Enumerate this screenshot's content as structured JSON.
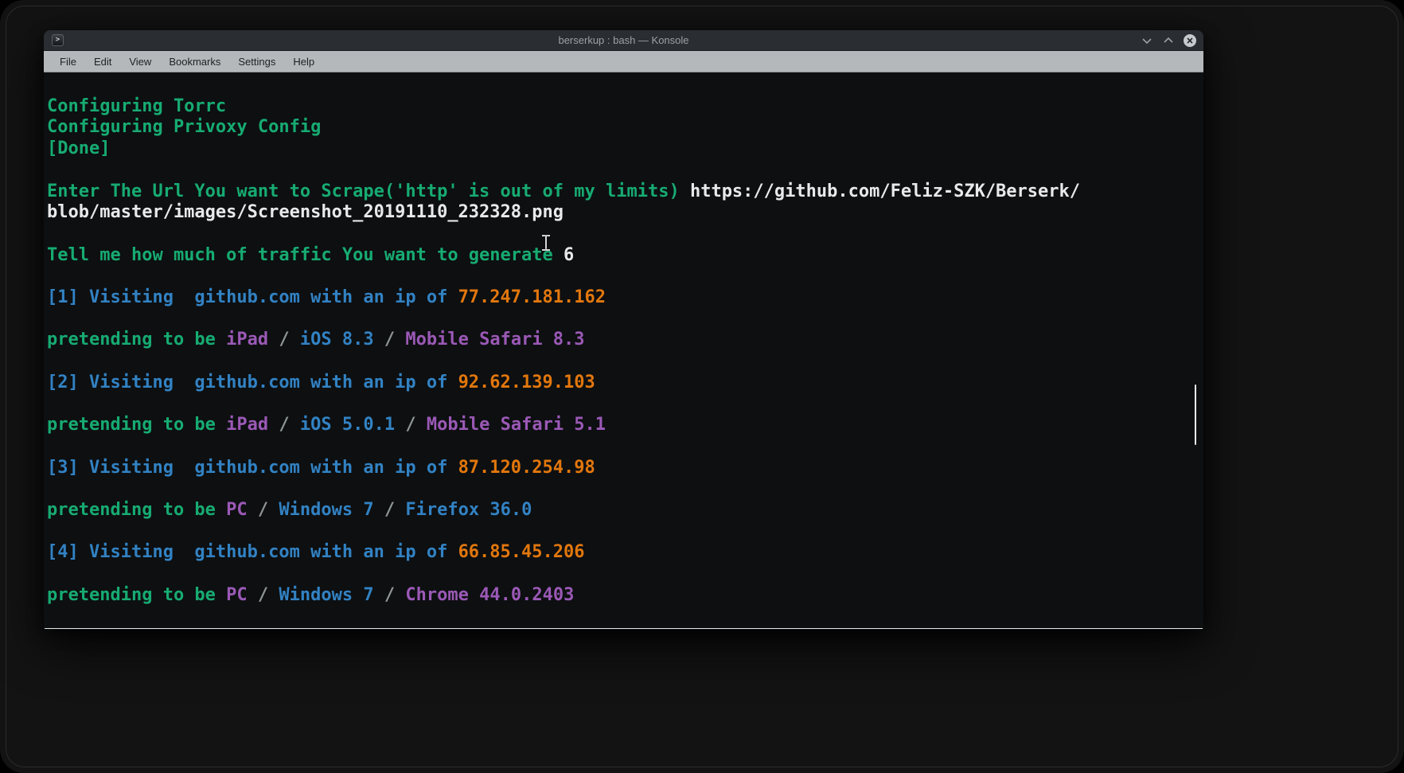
{
  "window": {
    "title": "berserkup : bash — Konsole",
    "app_icon": {
      "name": "konsole-terminal-icon",
      "glyph": ">"
    },
    "controls": [
      {
        "name": "minimize",
        "icon": "chevron-down-icon"
      },
      {
        "name": "maximize",
        "icon": "chevron-up-icon"
      },
      {
        "name": "close",
        "icon": "close-circle-icon"
      }
    ]
  },
  "menu": {
    "items": [
      "File",
      "Edit",
      "View",
      "Bookmarks",
      "Settings",
      "Help"
    ]
  },
  "palette": {
    "green": "#17ab72",
    "blue": "#3282c3",
    "orange": "#e2770d",
    "purple": "#9b59b6",
    "white": "#e8eaea",
    "gray": "#8f9696"
  },
  "cursor_icon": "i-beam-text-cursor",
  "terminal": {
    "lines": [
      [],
      [
        {
          "t": "Configuring Torrc",
          "c": "green"
        }
      ],
      [
        {
          "t": "Configuring Privoxy Config",
          "c": "green"
        }
      ],
      [
        {
          "t": "[Done]",
          "c": "green"
        }
      ],
      [],
      [
        {
          "t": "Enter The Url You want to Scrape('http' is out of my limits) ",
          "c": "green"
        },
        {
          "t": "https://github.com/Feliz-SZK/Berserk/",
          "c": "white"
        }
      ],
      [
        {
          "t": "blob/master/images/Screenshot_20191110_232328.png",
          "c": "white"
        }
      ],
      [],
      [
        {
          "t": "Tell me how much of traffic You want to generate ",
          "c": "green"
        },
        {
          "t": "6",
          "c": "white"
        }
      ],
      [],
      [
        {
          "t": "[1] Visiting  github.com with an ip of ",
          "c": "blue"
        },
        {
          "t": "77.247.181.162",
          "c": "orange"
        }
      ],
      [],
      [
        {
          "t": "pretending to be ",
          "c": "green"
        },
        {
          "t": "iPad",
          "c": "purple"
        },
        {
          "t": " / ",
          "c": "gray"
        },
        {
          "t": "iOS 8.3",
          "c": "blue"
        },
        {
          "t": " / ",
          "c": "gray"
        },
        {
          "t": "Mobile Safari 8.3",
          "c": "purple"
        }
      ],
      [],
      [
        {
          "t": "[2] Visiting  github.com with an ip of ",
          "c": "blue"
        },
        {
          "t": "92.62.139.103",
          "c": "orange"
        }
      ],
      [],
      [
        {
          "t": "pretending to be ",
          "c": "green"
        },
        {
          "t": "iPad",
          "c": "purple"
        },
        {
          "t": " / ",
          "c": "gray"
        },
        {
          "t": "iOS 5.0.1",
          "c": "blue"
        },
        {
          "t": " / ",
          "c": "gray"
        },
        {
          "t": "Mobile Safari 5.1",
          "c": "purple"
        }
      ],
      [],
      [
        {
          "t": "[3] Visiting  github.com with an ip of ",
          "c": "blue"
        },
        {
          "t": "87.120.254.98",
          "c": "orange"
        }
      ],
      [],
      [
        {
          "t": "pretending to be ",
          "c": "green"
        },
        {
          "t": "PC",
          "c": "purple"
        },
        {
          "t": " / ",
          "c": "gray"
        },
        {
          "t": "Windows 7",
          "c": "blue"
        },
        {
          "t": " / ",
          "c": "gray"
        },
        {
          "t": "Firefox 36.0",
          "c": "blue"
        }
      ],
      [],
      [
        {
          "t": "[4] Visiting  github.com with an ip of ",
          "c": "blue"
        },
        {
          "t": "66.85.45.206",
          "c": "orange"
        }
      ],
      [],
      [
        {
          "t": "pretending to be ",
          "c": "green"
        },
        {
          "t": "PC",
          "c": "purple"
        },
        {
          "t": " / ",
          "c": "gray"
        },
        {
          "t": "Windows 7",
          "c": "blue"
        },
        {
          "t": " / ",
          "c": "gray"
        },
        {
          "t": "Chrome 44.0.2403",
          "c": "purple"
        }
      ]
    ]
  }
}
